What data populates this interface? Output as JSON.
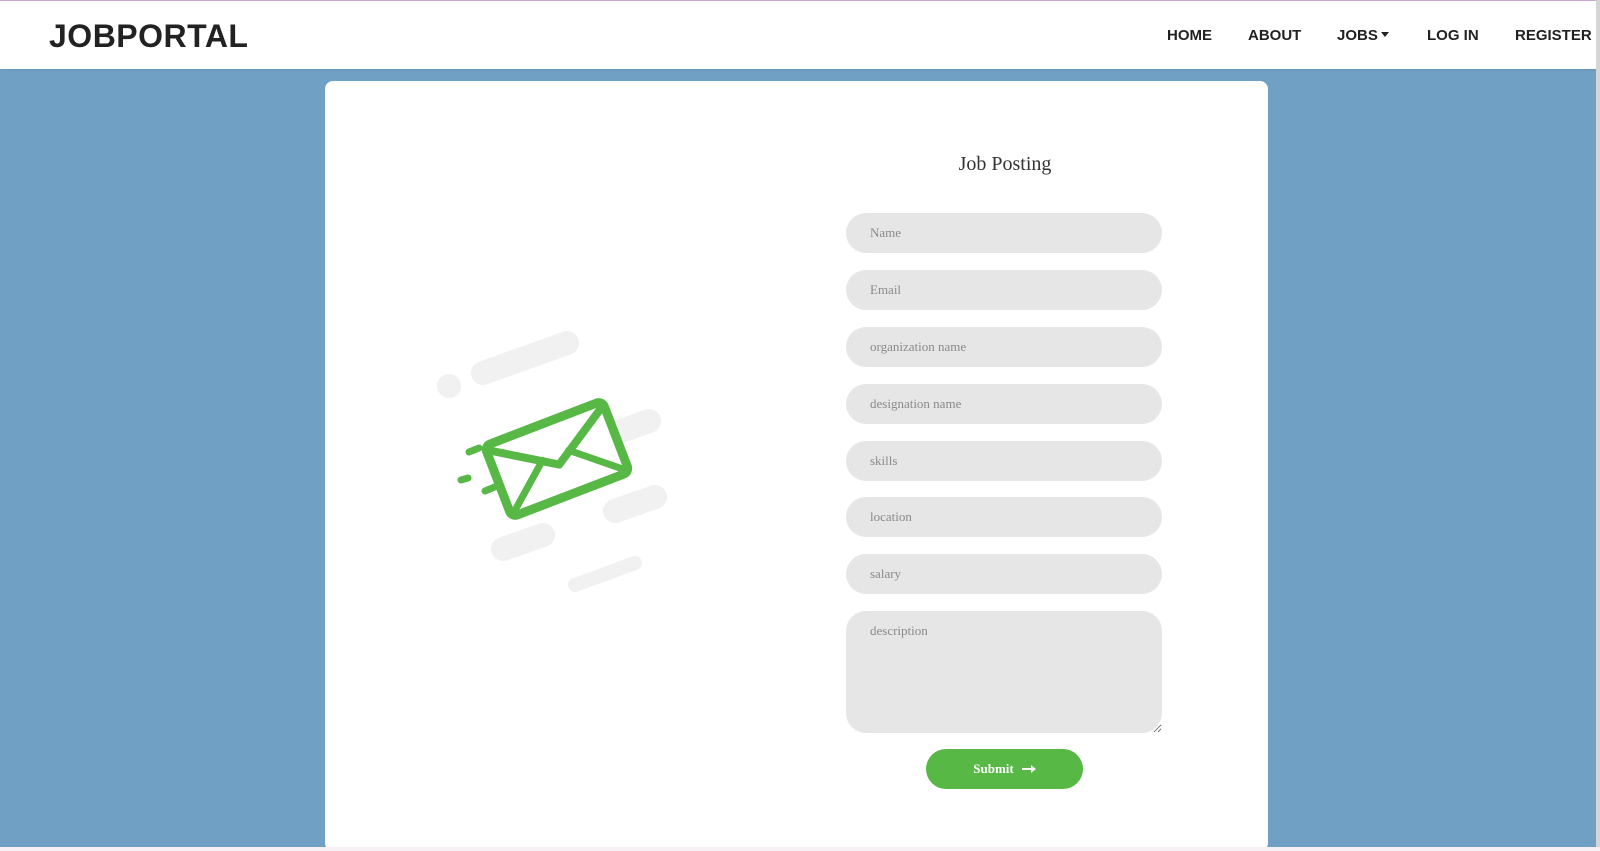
{
  "navbar": {
    "brand": "JOBPORTAL",
    "items": [
      {
        "label": "HOME"
      },
      {
        "label": "ABOUT"
      },
      {
        "label": "JOBS"
      },
      {
        "label": "LOG IN"
      },
      {
        "label": "REGISTER"
      }
    ]
  },
  "form": {
    "title": "Job Posting",
    "fields": [
      {
        "placeholder": "Name",
        "value": ""
      },
      {
        "placeholder": "Email",
        "value": ""
      },
      {
        "placeholder": "organization name",
        "value": ""
      },
      {
        "placeholder": "designation name",
        "value": ""
      },
      {
        "placeholder": "skills",
        "value": ""
      },
      {
        "placeholder": "location",
        "value": ""
      },
      {
        "placeholder": "salary",
        "value": ""
      },
      {
        "placeholder": "description",
        "value": ""
      }
    ],
    "submit_label": "Submit"
  },
  "icons": {
    "illustration": "envelope-icon",
    "submit_arrow": "arrow-right-icon",
    "jobs_caret": "caret-down-icon"
  },
  "colors": {
    "background": "#70a1c4",
    "accent": "#57b846",
    "field_bg": "#e6e6e6"
  }
}
